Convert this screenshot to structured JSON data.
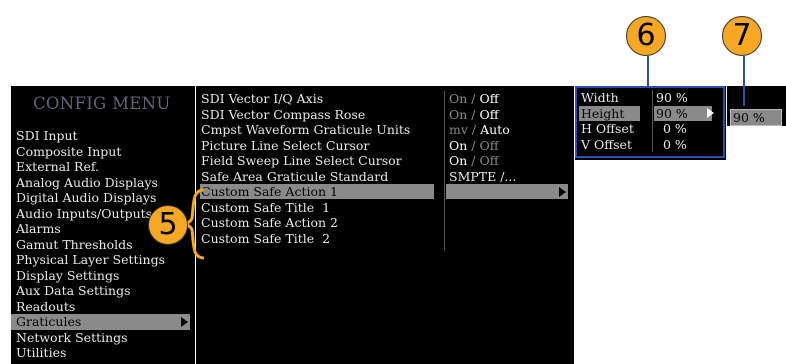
{
  "config_menu": {
    "title": "CONFIG MENU",
    "items": [
      {
        "label": "SDI Input"
      },
      {
        "label": "Composite Input"
      },
      {
        "label": "External Ref."
      },
      {
        "label": "Analog Audio Displays"
      },
      {
        "label": "Digital Audio Displays"
      },
      {
        "label": "Audio Inputs/Outputs"
      },
      {
        "label": "Alarms"
      },
      {
        "label": "Gamut Thresholds"
      },
      {
        "label": "Physical Layer Settings"
      },
      {
        "label": "Display Settings"
      },
      {
        "label": "Aux Data Settings"
      },
      {
        "label": "Readouts"
      },
      {
        "label": "Graticules"
      },
      {
        "label": "Network Settings"
      },
      {
        "label": "Utilities"
      }
    ],
    "selected": "Graticules"
  },
  "graticule_menu": {
    "rows": [
      {
        "label": "SDI Vector I/Q Axis",
        "on": "On",
        "sep": "/",
        "off": "Off",
        "active": "off"
      },
      {
        "label": "SDI Vector Compass Rose",
        "on": "On",
        "sep": "/",
        "off": "Off",
        "active": "off"
      },
      {
        "label": "Cmpst Waveform Graticule Units",
        "on": "mv",
        "sep": "/",
        "off": "Auto",
        "active": "off"
      },
      {
        "label": "Picture Line Select Cursor",
        "on": "On",
        "sep": "/",
        "off": "Off",
        "active": "on"
      },
      {
        "label": "Field Sweep Line Select Cursor",
        "on": "On",
        "sep": "/",
        "off": "Off",
        "active": "on"
      },
      {
        "label": "Safe Area Graticule Standard",
        "value": "SMPTE /..."
      },
      {
        "label": "Custom Safe Action 1",
        "selected": true
      },
      {
        "label": "Custom Safe Title  1"
      },
      {
        "label": "Custom Safe Action 2"
      },
      {
        "label": "Custom Safe Title  2"
      }
    ]
  },
  "size_panel": {
    "rows": [
      {
        "label": "Width",
        "value": "90 %"
      },
      {
        "label": "Height",
        "value": "90 %",
        "selected": true
      },
      {
        "label": "H Offset",
        "value": "0 %"
      },
      {
        "label": "V Offset",
        "value": "0 %"
      }
    ]
  },
  "value_box": {
    "value": "90 %"
  },
  "callouts": {
    "c5": "5",
    "c6": "6",
    "c7": "7"
  },
  "colors": {
    "accent_blue": "#2a4fb0",
    "callout_orange": "#f7a823",
    "menu_bg": "#000000",
    "title_color": "#5f6478"
  }
}
